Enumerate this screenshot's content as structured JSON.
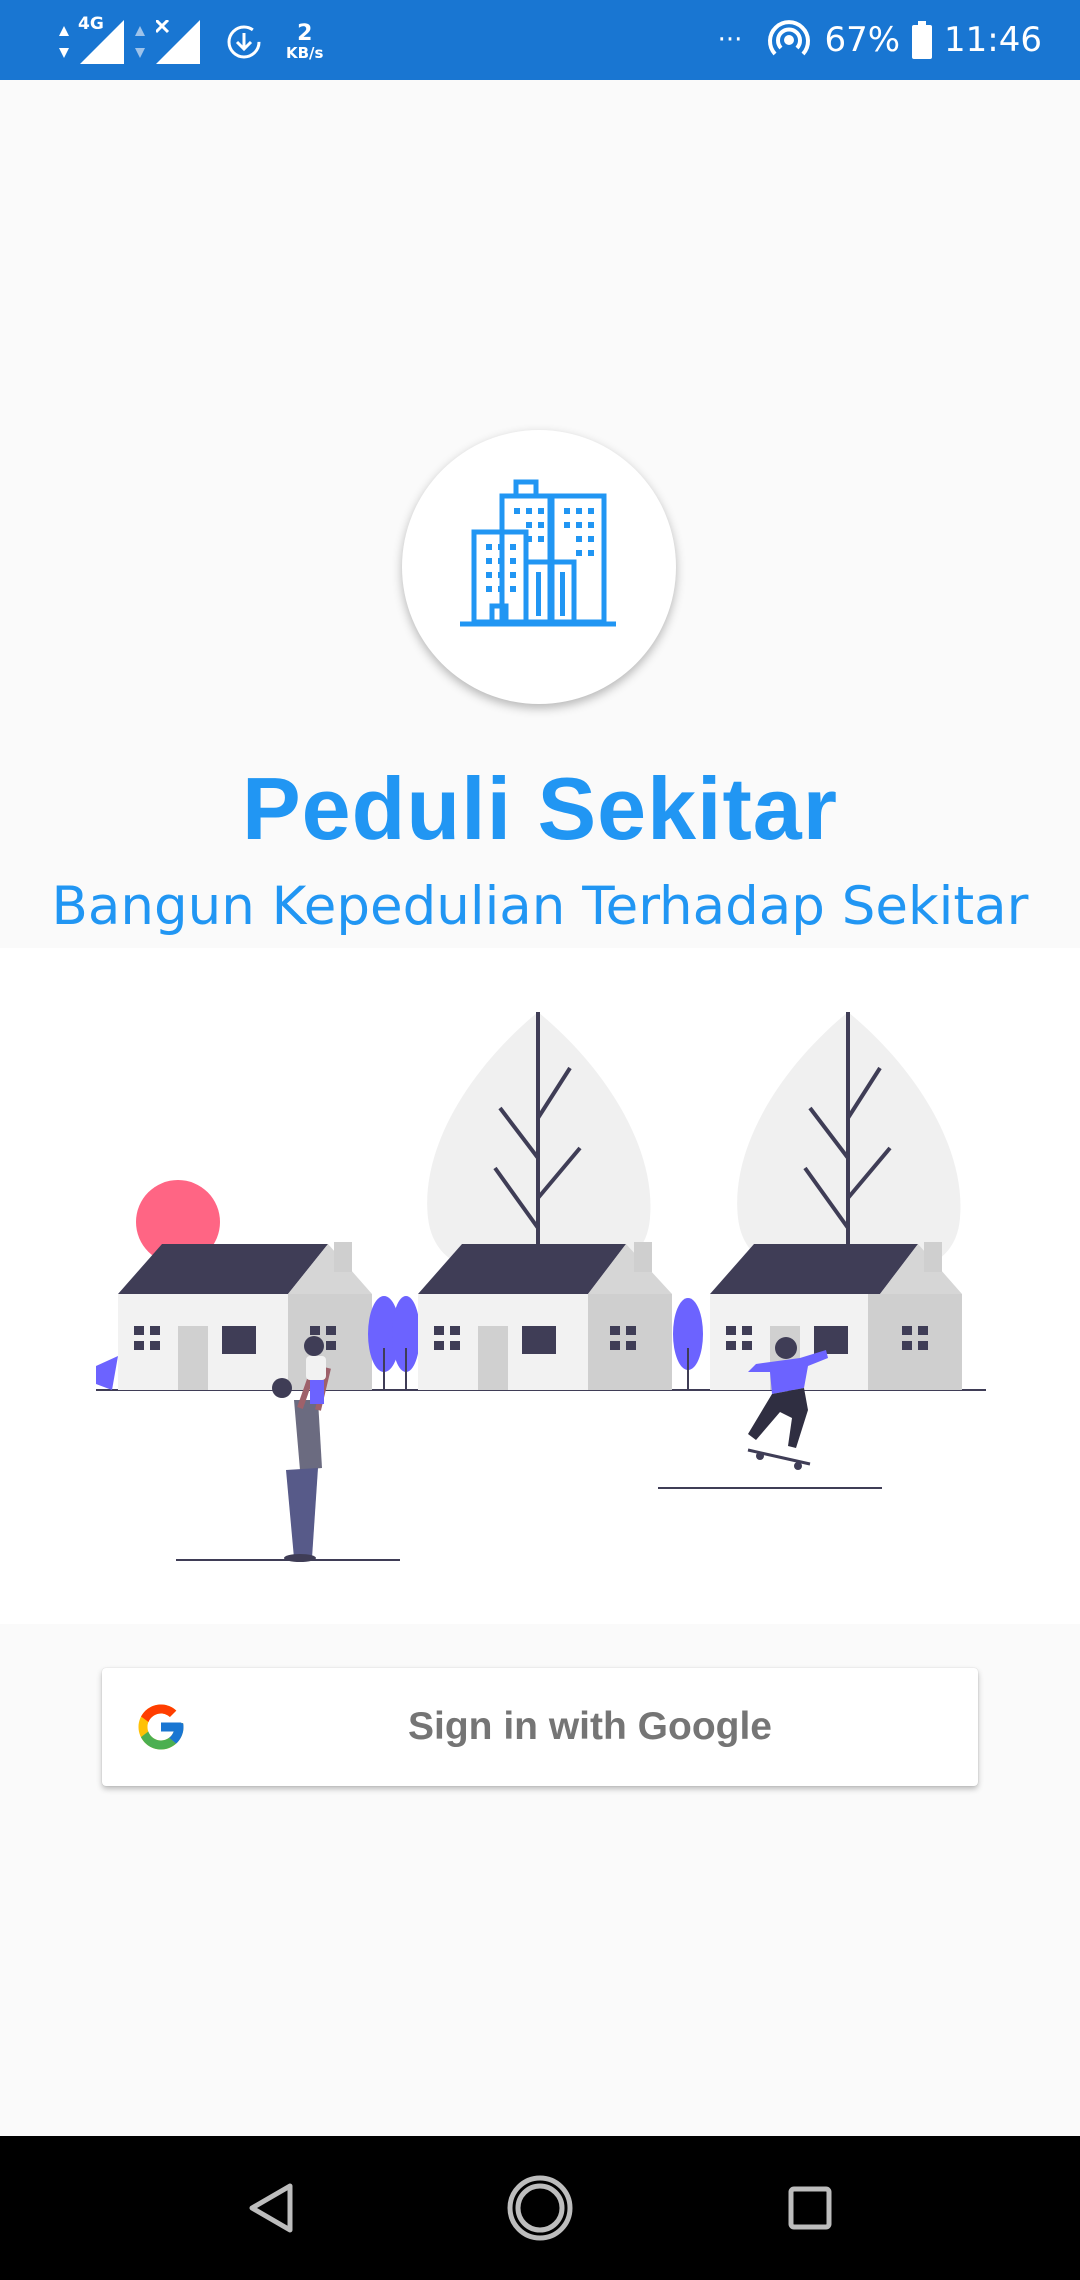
{
  "status_bar": {
    "network_type": "4G",
    "data_speed_value": "2",
    "data_speed_unit": "KB/s",
    "more_indicator": "···",
    "battery_percent": "67%",
    "time": "11:46",
    "background_color": "#1976d2"
  },
  "app": {
    "title": "Peduli Sekitar",
    "subtitle": "Bangun Kepedulian Terhadap Sekitar",
    "accent_color": "#2196f3",
    "logo_icon": "city-buildings-icon"
  },
  "illustration": {
    "name": "neighborhood-illustration"
  },
  "sign_in": {
    "button_label": "Sign in with Google",
    "icon": "google-logo-icon"
  },
  "nav_bar": {
    "back": "back-icon",
    "home": "home-icon",
    "recents": "recents-icon"
  }
}
